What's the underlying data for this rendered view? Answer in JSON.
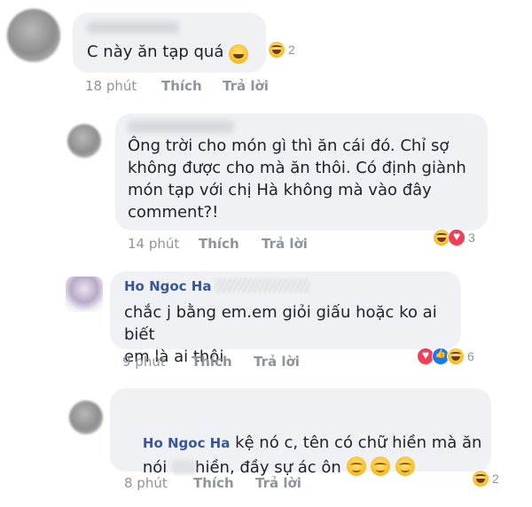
{
  "comments": [
    {
      "text": "C này ăn tạp quá",
      "time": "18 phút",
      "like_label": "Thích",
      "reply_label": "Trả lời",
      "reactions": [
        "laugh"
      ],
      "reaction_count": "2"
    },
    {
      "text": "Ông trời cho món gì thì ăn cái đó. Chỉ sợ\nkhông được cho mà ăn thôi. Có định giành\nmón tạp với chị Hà không mà vào đây\ncomment?!",
      "time": "14 phút",
      "like_label": "Thích",
      "reply_label": "Trả lời",
      "reactions": [
        "laugh",
        "love"
      ],
      "reaction_count": "3"
    },
    {
      "author": "Ho Ngoc Ha",
      "text": "chắc j bằng em.em giỏi giấu hoặc ko ai biết\nem là ai thôi",
      "time": "9 phút",
      "like_label": "Thích",
      "reply_label": "Trả lời",
      "reactions": [
        "love",
        "like",
        "laugh"
      ],
      "reaction_count": "6"
    },
    {
      "mention": "Ho Ngoc Ha",
      "text_a": " kệ nó c, tên có chữ hiền mà ăn",
      "text_b": "nói ",
      "text_c": "hiền, đầy sự ác ôn ",
      "time": "8 phút",
      "like_label": "Thích",
      "reply_label": "Trả lời",
      "reactions": [
        "laugh"
      ],
      "reaction_count": "2"
    }
  ],
  "colors": {
    "bubble": "#f0f1f4",
    "name": "#385898",
    "meta": "#8d949e",
    "love": "#f33e58",
    "like": "#1877f2",
    "emoji": "#f7c233"
  },
  "icons": [
    "laugh-emoji-icon",
    "love-reaction-icon",
    "like-reaction-icon",
    "relieved-emoji-icon"
  ]
}
